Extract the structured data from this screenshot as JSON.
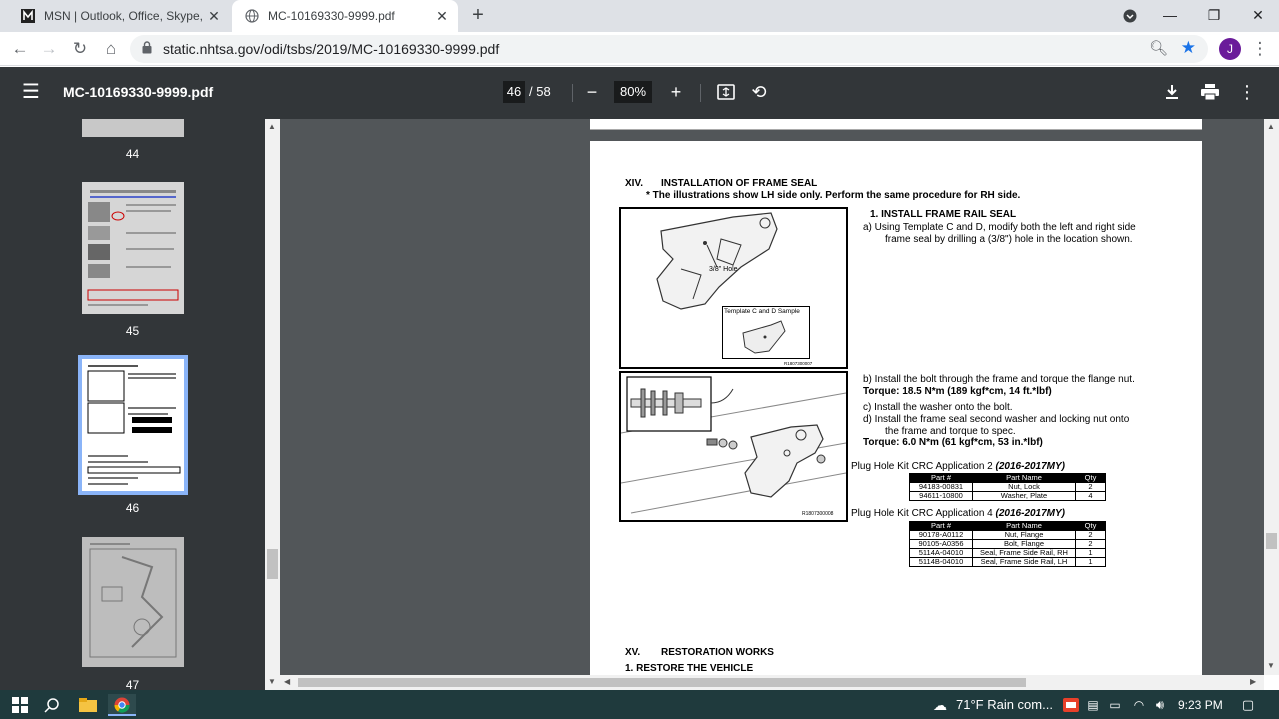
{
  "tabs": [
    {
      "title": "MSN | Outlook, Office, Skype, Bing",
      "icon": "msn-icon"
    },
    {
      "title": "MC-10169330-9999.pdf",
      "icon": "globe-icon"
    }
  ],
  "address": {
    "url": "static.nhtsa.gov/odi/tsbs/2019/MC-10169330-9999.pdf",
    "avatar": "J"
  },
  "pdf_toolbar": {
    "title": "MC-10169330-9999.pdf",
    "page": "46",
    "total": "/ 58",
    "zoom": "80%"
  },
  "thumbnails": [
    {
      "label": "44"
    },
    {
      "label": "45"
    },
    {
      "label": "46"
    },
    {
      "label": "47"
    }
  ],
  "doc": {
    "sec14_num": "XIV.",
    "sec14_title": "INSTALLATION OF FRAME SEAL",
    "sec14_note": "* The illustrations show LH side only. Perform the same procedure for RH side.",
    "step1_title": "1.   INSTALL FRAME RAIL SEAL",
    "step_a1": "a)   Using Template C and D, modify both the left and right side",
    "step_a2": "frame seal by drilling a (3/8\") hole in the location shown.",
    "fig1_hole": "3/8\" Hole",
    "fig1_template": "Template C and D Sample",
    "fig1_code": "R1807300007",
    "fig2_code": "R1807300008",
    "step_b": "b)   Install the bolt through the frame and torque the flange nut.",
    "torque1": "Torque: 18.5 N*m (189 kgf*cm, 14 ft.*lbf)",
    "step_c": "c)   Install the washer onto the bolt.",
    "step_d1": "d)   Install the frame seal second washer and locking nut onto",
    "step_d2": "the frame and torque to spec.",
    "torque2": "Torque: 6.0 N*m (61 kgf*cm, 53 in.*lbf)",
    "kit2_title": "Plug Hole Kit CRC Application 2 ",
    "kit2_year": "(2016-2017MY)",
    "kit4_title": "Plug Hole Kit CRC Application 4 ",
    "kit4_year": "(2016-2017MY)",
    "table_headers": [
      "Part #",
      "Part Name",
      "Qty"
    ],
    "kit2_rows": [
      [
        "94183-00831",
        "Nut, Lock",
        "2"
      ],
      [
        "94611-10800",
        "Washer, Plate",
        "4"
      ]
    ],
    "kit4_rows": [
      [
        "90178-A0112",
        "Nut, Flange",
        "2"
      ],
      [
        "90105-A0356",
        "Bolt, Flange",
        "2"
      ],
      [
        "5114A-04010",
        "Seal, Frame Side Rail, RH",
        "1"
      ],
      [
        "5114B-04010",
        "Seal, Frame Side Rail, LH",
        "1"
      ]
    ],
    "sec15_num": "XV.",
    "sec15_title": "RESTORATION WORKS",
    "restore": "1.   RESTORE THE VEHICLE"
  },
  "taskbar": {
    "weather": "71°F  Rain com...",
    "time": "9:23 PM"
  }
}
